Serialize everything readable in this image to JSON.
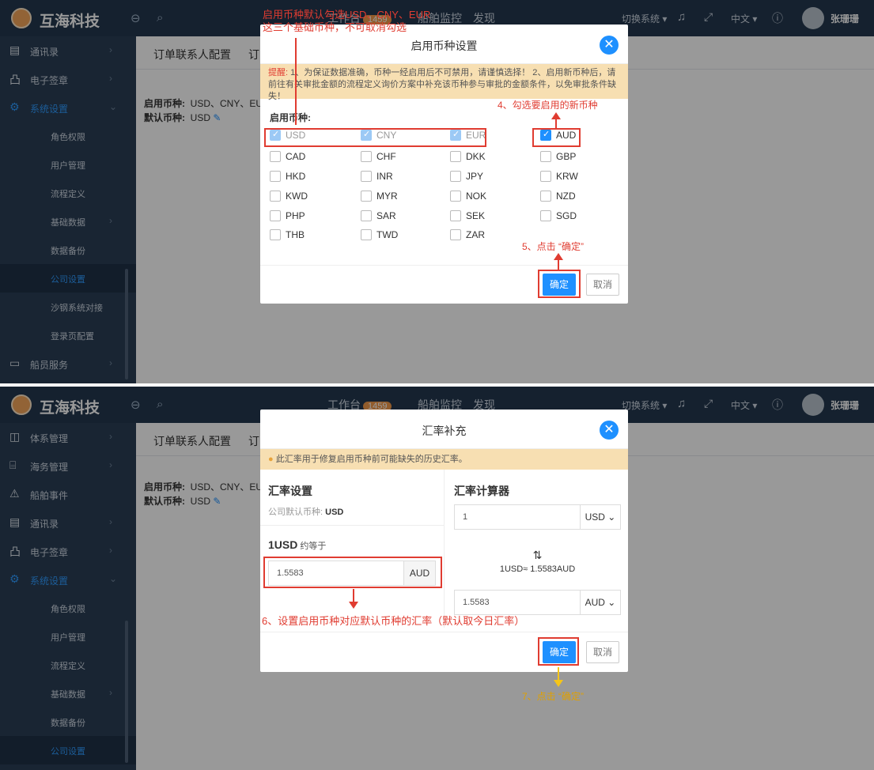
{
  "app": {
    "brand": "互海科技",
    "topnav": {
      "workbench": "工作台",
      "badge": "1459",
      "ship_monitor": "船舶监控",
      "discover": "发现"
    },
    "switch_system": "切换系统 ▾",
    "language": "中文 ▾",
    "user_name": "张珊珊"
  },
  "sidebar1": [
    {
      "label": "通讯录",
      "icon": "contacts-icon",
      "glyph": "▤",
      "arrow": "›"
    },
    {
      "label": "电子签章",
      "icon": "seal-icon",
      "glyph": "凸",
      "arrow": "›"
    },
    {
      "label": "系统设置",
      "icon": "gear-icon",
      "glyph": "⚙",
      "arrow": "⌄"
    },
    {
      "label": "角色权限"
    },
    {
      "label": "用户管理"
    },
    {
      "label": "流程定义"
    },
    {
      "label": "基础数据",
      "arrow": "›"
    },
    {
      "label": "数据备份"
    },
    {
      "label": "公司设置"
    },
    {
      "label": "沙钢系统对接"
    },
    {
      "label": "登录页配置"
    },
    {
      "label": "船员服务",
      "icon": "crew-icon",
      "glyph": "▭",
      "arrow": "›"
    }
  ],
  "sidebar2": [
    {
      "label": "体系管理",
      "icon": "system-icon",
      "glyph": "◫",
      "arrow": "›"
    },
    {
      "label": "海务管理",
      "icon": "marine-icon",
      "glyph": "⌸",
      "arrow": "›"
    },
    {
      "label": "船舶事件",
      "icon": "warning-icon",
      "glyph": "⚠"
    },
    {
      "label": "通讯录",
      "icon": "contacts-icon",
      "glyph": "▤",
      "arrow": "›"
    },
    {
      "label": "电子签章",
      "icon": "seal-icon",
      "glyph": "凸",
      "arrow": "›"
    },
    {
      "label": "系统设置",
      "icon": "gear-icon",
      "glyph": "⚙",
      "arrow": "⌄"
    },
    {
      "label": "角色权限"
    },
    {
      "label": "用户管理"
    },
    {
      "label": "流程定义"
    },
    {
      "label": "基础数据",
      "arrow": "›"
    },
    {
      "label": "数据备份"
    },
    {
      "label": "公司设置"
    }
  ],
  "content": {
    "tab1": "订单联系人配置",
    "tab2": "订",
    "enabled_label": "启用币种:",
    "enabled_value": "USD、CNY、EU",
    "default_label": "默认币种:",
    "default_value": "USD"
  },
  "modal1": {
    "title": "启用币种设置",
    "warning_label": "提醒:",
    "warning_text": "1、为保证数据准确，币种一经启用后不可禁用，请谨慎选择！ 2、启用新币种后，请前往有关审批金额的流程定义询价方案中补充该币种参与审批的金额条件，以免审批条件缺失！",
    "section_label": "启用币种:",
    "currencies": [
      {
        "code": "USD",
        "state": "locked"
      },
      {
        "code": "CNY",
        "state": "locked"
      },
      {
        "code": "EUR",
        "state": "locked"
      },
      {
        "code": "AUD",
        "state": "checked"
      },
      {
        "code": "CAD",
        "state": "off"
      },
      {
        "code": "CHF",
        "state": "off"
      },
      {
        "code": "DKK",
        "state": "off"
      },
      {
        "code": "GBP",
        "state": "off"
      },
      {
        "code": "HKD",
        "state": "off"
      },
      {
        "code": "INR",
        "state": "off"
      },
      {
        "code": "JPY",
        "state": "off"
      },
      {
        "code": "KRW",
        "state": "off"
      },
      {
        "code": "KWD",
        "state": "off"
      },
      {
        "code": "MYR",
        "state": "off"
      },
      {
        "code": "NOK",
        "state": "off"
      },
      {
        "code": "NZD",
        "state": "off"
      },
      {
        "code": "PHP",
        "state": "off"
      },
      {
        "code": "SAR",
        "state": "off"
      },
      {
        "code": "SEK",
        "state": "off"
      },
      {
        "code": "SGD",
        "state": "off"
      },
      {
        "code": "THB",
        "state": "off"
      },
      {
        "code": "TWD",
        "state": "off"
      },
      {
        "code": "ZAR",
        "state": "off"
      }
    ],
    "confirm": "确定",
    "cancel": "取消"
  },
  "annotations1": {
    "a1_line1": "启用币种默认勾选USD、CNY、EUR",
    "a1_line2": "这三个基础币种，不可取消勾选",
    "a4": "4、勾选要启用的新币种",
    "a5": "5、点击 “确定”"
  },
  "modal2": {
    "title": "汇率补充",
    "notice": "此汇率用于修复启用币种前可能缺失的历史汇率。",
    "settings_title": "汇率设置",
    "default_label": "公司默认币种:",
    "default_value": "USD",
    "approx_strong": "1USD",
    "approx_text": "约等于",
    "rate_value": "1.5583",
    "rate_currency": "AUD",
    "calc_title": "汇率计算器",
    "calc_input1": "1",
    "calc_cur1": "USD ⌄",
    "swap_icon": "⇅",
    "calc_result": "1USD≈ 1.5583AUD",
    "calc_input2": "1.5583",
    "calc_cur2": "AUD ⌄",
    "confirm": "确定",
    "cancel": "取消"
  },
  "annotations2": {
    "a6": "6、设置启用币种对应默认币种的汇率（默认取今日汇率）",
    "a7": "7、点击 “确定”"
  },
  "colors": {
    "accent": "#1e90ff",
    "annotation": "#e03c31",
    "sidebar": "#2b3f55",
    "topbar": "#23384f"
  }
}
